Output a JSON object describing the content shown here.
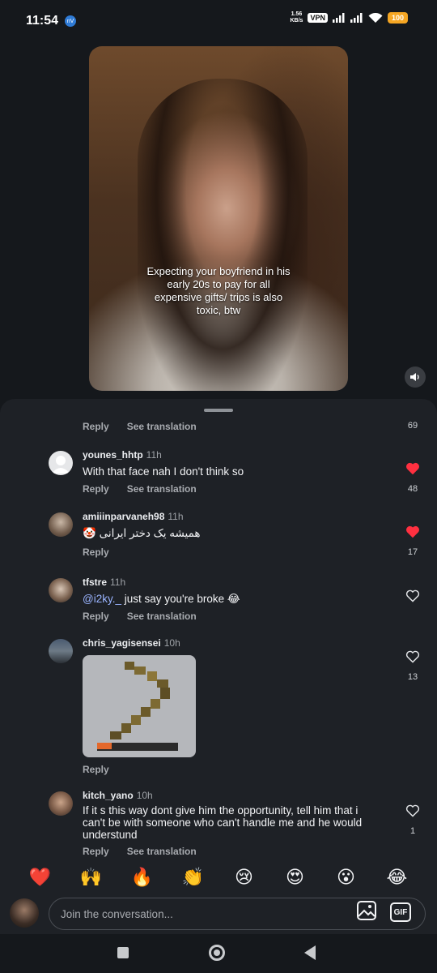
{
  "status_bar": {
    "time": "11:54",
    "app_badge": "nV",
    "net_speed_value": "1.56",
    "net_speed_unit": "KB/s",
    "vpn": "VPN",
    "battery": "100"
  },
  "video": {
    "caption": "Expecting your boyfriend in his early 20s to pay for all expensive gifts/ trips is also toxic, btw"
  },
  "top_row": {
    "reply": "Reply",
    "translate": "See translation",
    "likes": "69"
  },
  "comments": [
    {
      "user": "younes_hhtp",
      "time": "11h",
      "text": "With that face nah I don't think so",
      "reply": "Reply",
      "translate": "See translation",
      "liked": true,
      "likes": "48"
    },
    {
      "user": "amiiinparvaneh98",
      "time": "11h",
      "text": "همیشه یک دختر ایرانی",
      "emoji": "🤡",
      "reply": "Reply",
      "translate": "",
      "liked": true,
      "likes": "17"
    },
    {
      "user": "tfstre",
      "time": "11h",
      "mention": "@i2ky._",
      "text": " just say you're broke 😂",
      "reply": "Reply",
      "translate": "See translation",
      "liked": false,
      "likes": ""
    },
    {
      "user": "chris_yagisensei",
      "time": "10h",
      "text": "",
      "reply": "Reply",
      "translate": "",
      "liked": false,
      "likes": "13"
    },
    {
      "user": "kitch_yano",
      "time": "10h",
      "text": "If it s this way dont give him the opportunity,  tell him that i can't be with someone who can't handle me and he would understund",
      "reply": "Reply",
      "translate": "See translation",
      "liked": false,
      "likes": "1"
    }
  ],
  "emoji_bar": [
    "❤️",
    "🙌",
    "🔥",
    "👏",
    "😢",
    "😍",
    "😮",
    "😂"
  ],
  "input": {
    "placeholder": "Join the conversation...",
    "gif": "GIF"
  },
  "colors": {
    "like_red": "#ff3040",
    "background": "#15181c",
    "sheet": "#1e2126",
    "mention": "#9ab4ff"
  }
}
